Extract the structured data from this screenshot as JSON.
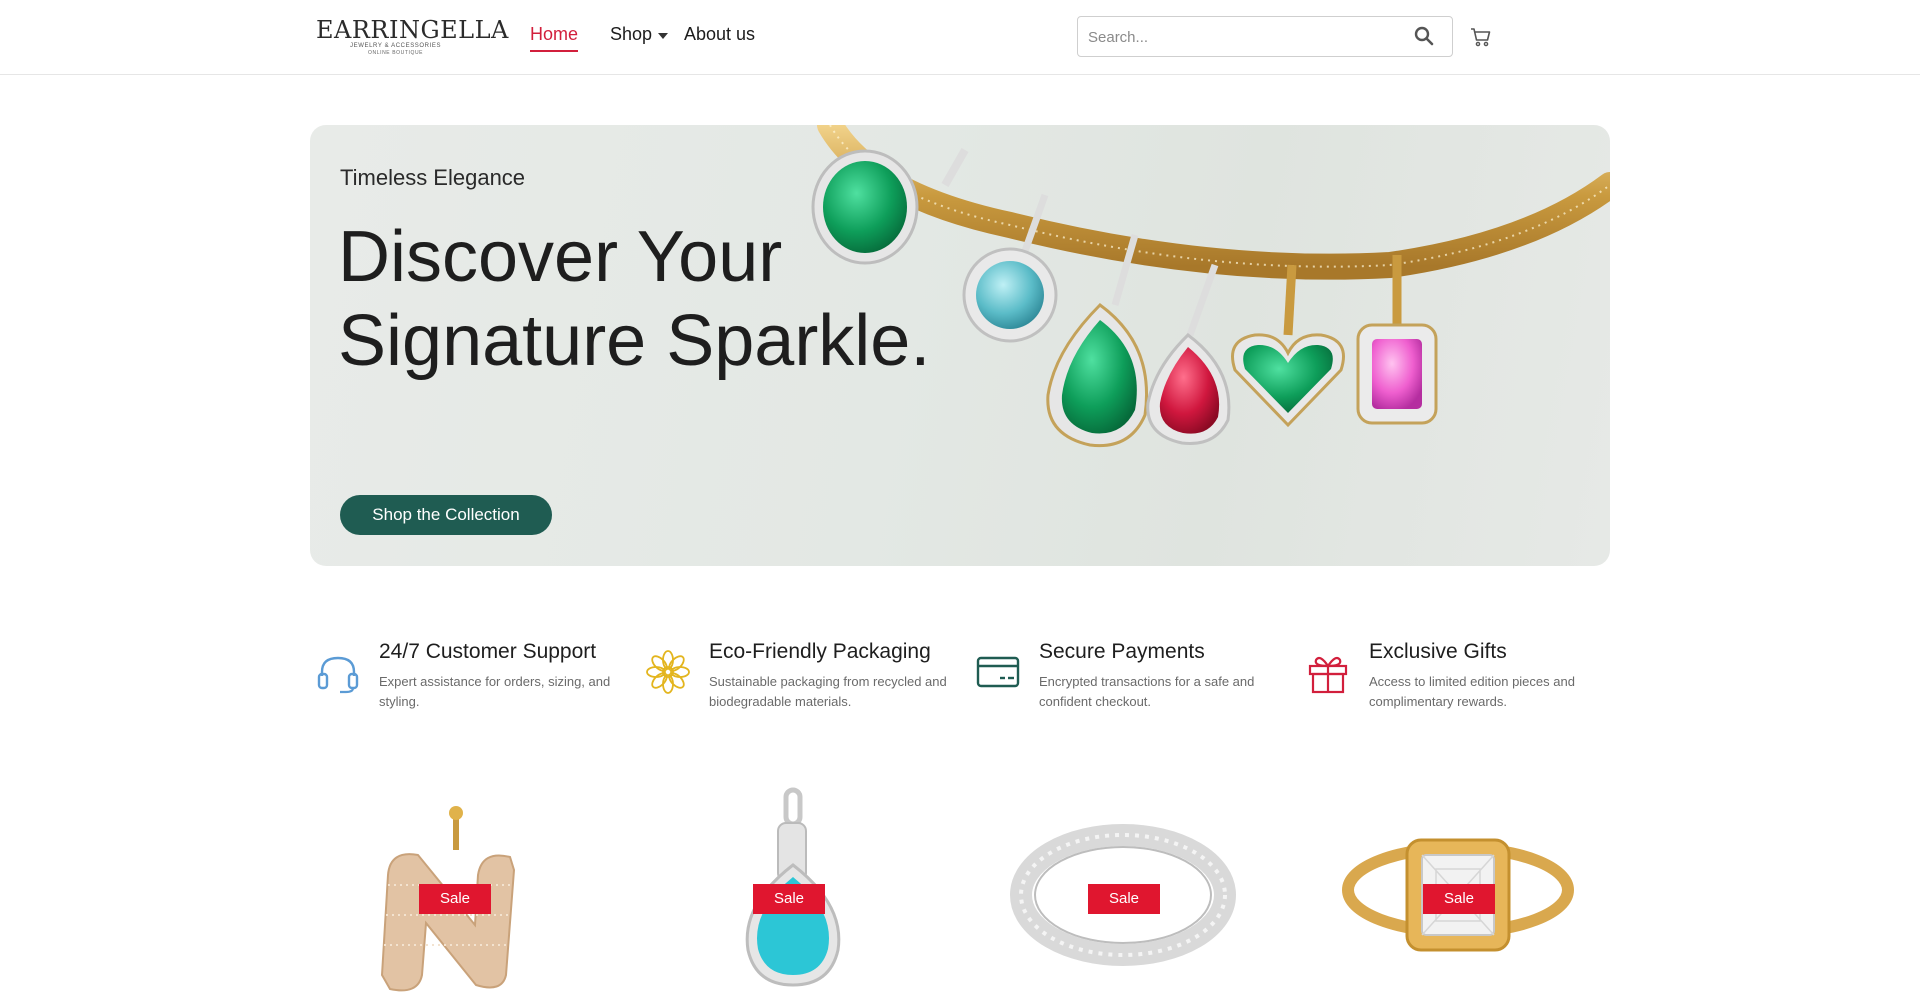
{
  "brand": {
    "logo_text": "EARRINGELLA",
    "tagline": "JEWELRY & ACCESSORIES",
    "sub_tagline": "ONLINE BOUTIQUE"
  },
  "nav": {
    "home": "Home",
    "shop": "Shop",
    "about": "About us"
  },
  "search": {
    "placeholder": "Search..."
  },
  "hero": {
    "eyebrow": "Timeless Elegance",
    "title": "Discover Your Signature Sparkle.",
    "cta": "Shop the Collection"
  },
  "features": [
    {
      "title": "24/7 Customer Support",
      "desc": "Expert assistance for orders, sizing, and styling.",
      "icon": "headset-icon"
    },
    {
      "title": "Eco-Friendly Packaging",
      "desc": "Sustainable packaging from recycled and biodegradable materials.",
      "icon": "flower-icon"
    },
    {
      "title": "Secure Payments",
      "desc": "Encrypted transactions for a safe and confident checkout.",
      "icon": "credit-card-icon"
    },
    {
      "title": "Exclusive Gifts",
      "desc": "Access to limited edition pieces and complimentary rewards.",
      "icon": "gift-icon"
    }
  ],
  "products": [
    {
      "badge": "Sale"
    },
    {
      "badge": "Sale"
    },
    {
      "badge": "Sale"
    },
    {
      "badge": "Sale"
    }
  ],
  "colors": {
    "accent": "#d21f3c",
    "cta": "#1f5c52",
    "sale": "#e0162f"
  }
}
